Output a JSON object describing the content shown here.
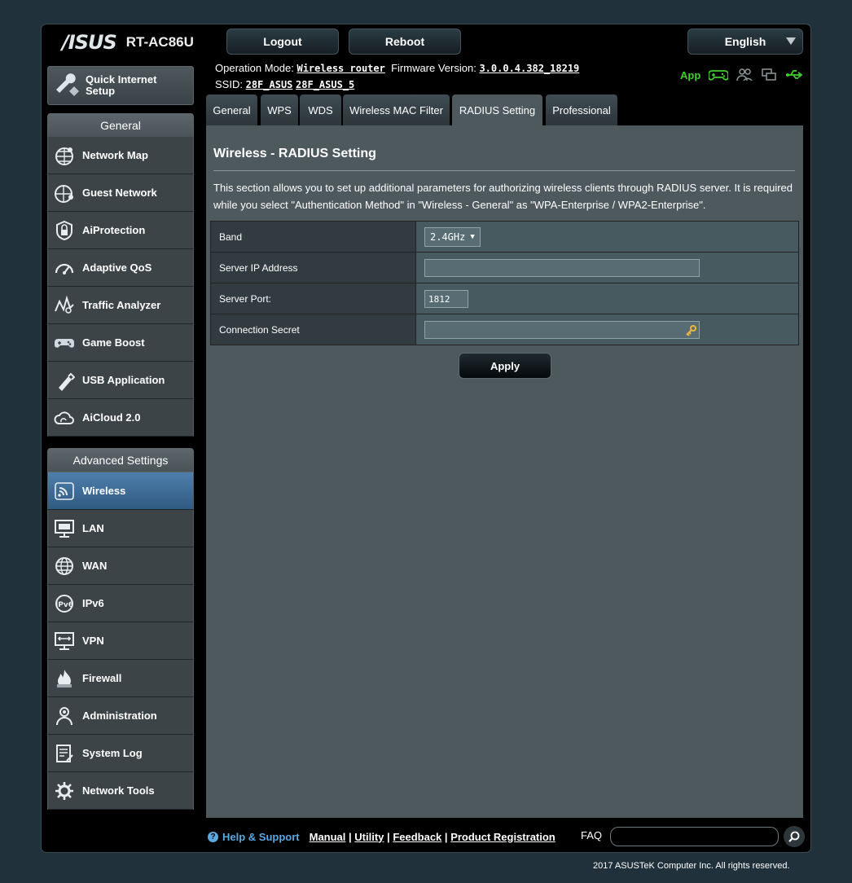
{
  "header": {
    "brand": "/ISUS",
    "model": "RT-AC86U",
    "logout_label": "Logout",
    "reboot_label": "Reboot",
    "language": "English"
  },
  "status": {
    "operation_mode_label": "Operation Mode:",
    "operation_mode_value": "Wireless router",
    "firmware_label": "Firmware Version:",
    "firmware_value": "3.0.0.4.382_18219",
    "ssid_label": "SSID:",
    "ssid_1": "28F_ASUS",
    "ssid_2": "28F_ASUS_5",
    "app_label": "App",
    "icon_names": [
      "gamepad-icon",
      "users-icon",
      "devices-icon",
      "usb-icon"
    ]
  },
  "sidebar": {
    "quick_setup_line1": "Quick Internet",
    "quick_setup_line2": "Setup",
    "general_title": "General",
    "general_items": [
      {
        "label": "Network Map",
        "icon": "globe-icon"
      },
      {
        "label": "Guest Network",
        "icon": "guest-network-icon"
      },
      {
        "label": "AiProtection",
        "icon": "lock-icon"
      },
      {
        "label": "Adaptive QoS",
        "icon": "speedometer-icon"
      },
      {
        "label": "Traffic Analyzer",
        "icon": "analyzer-icon"
      },
      {
        "label": "Game Boost",
        "icon": "gamepad-icon"
      },
      {
        "label": "USB Application",
        "icon": "usb-stick-icon"
      },
      {
        "label": "AiCloud 2.0",
        "icon": "cloud-icon"
      }
    ],
    "advanced_title": "Advanced Settings",
    "advanced_items": [
      {
        "label": "Wireless",
        "icon": "wifi-icon",
        "active": true
      },
      {
        "label": "LAN",
        "icon": "lan-icon"
      },
      {
        "label": "WAN",
        "icon": "wan-globe-icon"
      },
      {
        "label": "IPv6",
        "icon": "ipv6-icon"
      },
      {
        "label": "VPN",
        "icon": "vpn-icon"
      },
      {
        "label": "Firewall",
        "icon": "flame-icon"
      },
      {
        "label": "Administration",
        "icon": "admin-icon"
      },
      {
        "label": "System Log",
        "icon": "log-icon"
      },
      {
        "label": "Network Tools",
        "icon": "tools-gear-icon"
      }
    ]
  },
  "tabs": [
    {
      "label": "General"
    },
    {
      "label": "WPS"
    },
    {
      "label": "WDS"
    },
    {
      "label": "Wireless MAC Filter"
    },
    {
      "label": "RADIUS Setting",
      "active": true
    },
    {
      "label": "Professional"
    }
  ],
  "content": {
    "title": "Wireless - RADIUS Setting",
    "description": "This section allows you to set up additional parameters for authorizing wireless clients through RADIUS server. It is required while you select \"Authentication Method\" in \"Wireless - General\" as \"WPA-Enterprise / WPA2-Enterprise\".",
    "fields": {
      "band_label": "Band",
      "band_value": "2.4GHz",
      "server_ip_label": "Server IP Address",
      "server_ip_value": "",
      "server_port_label": "Server Port:",
      "server_port_value": "1812",
      "secret_label": "Connection Secret",
      "secret_value": ""
    },
    "apply_label": "Apply"
  },
  "footer": {
    "help_label": "Help & Support",
    "manual": "Manual",
    "utility": "Utility",
    "feedback": "Feedback",
    "product_registration": "Product Registration",
    "sep": "|",
    "faq_label": "FAQ",
    "copyright": "2017 ASUSTeK Computer Inc. All rights reserved."
  },
  "colors": {
    "background": "#21313c",
    "content_bg": "#4d595d",
    "active_menu": "#3e6e98",
    "help_blue": "#5ba8e0",
    "status_green": "#3fcd2d"
  }
}
